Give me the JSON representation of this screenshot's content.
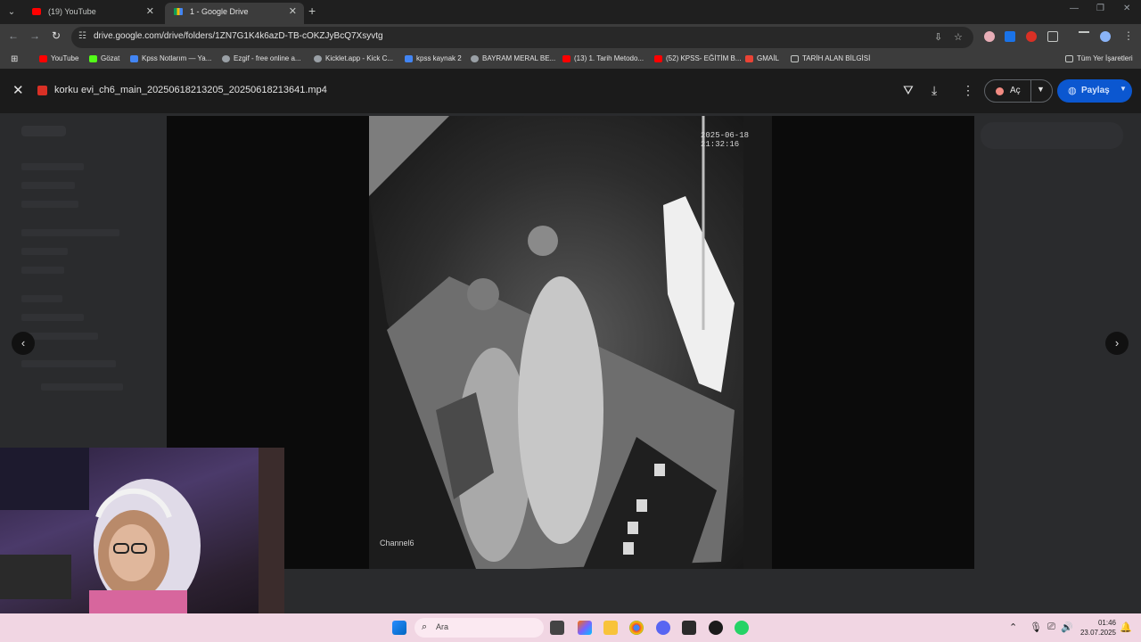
{
  "tabs": [
    {
      "title": "(19) YouTube",
      "favicon": "youtube-icon",
      "active": false
    },
    {
      "title": "1 - Google Drive",
      "favicon": "google-drive-icon",
      "active": true
    }
  ],
  "address_bar": {
    "url": "drive.google.com/drive/folders/1ZN7G1K4k6azD-TB-cOKZJyBcQ7Xsyvtg"
  },
  "bookmarks": [
    {
      "label": "YouTube",
      "color": "#ff0000"
    },
    {
      "label": "Gözat",
      "color": "#53fc18"
    },
    {
      "label": "Kpss Notlarım — Ya...",
      "color": "#4285f4"
    },
    {
      "label": "Ezgif - free online a...",
      "color": "#9aa0a6"
    },
    {
      "label": "Kicklet.app - Kick C...",
      "color": "#9aa0a6"
    },
    {
      "label": "kpss kaynak 2",
      "color": "#4285f4"
    },
    {
      "label": "BAYRAM MERAL BE...",
      "color": "#9aa0a6"
    },
    {
      "label": "(13) 1. Tarih Metodo...",
      "color": "#ff0000"
    },
    {
      "label": "(52) KPSS- EĞİTİM B...",
      "color": "#ff0000"
    },
    {
      "label": "GMAİL",
      "color": "#ea4335"
    },
    {
      "label": "TARİH ALAN BİLGİSİ",
      "color": "#9aa0a6"
    }
  ],
  "all_bookmarks": "Tüm Yer İşaretleri",
  "viewer": {
    "file_name": "korku evi_ch6_main_20250618213205_20250618213641.mp4",
    "open_with_label": "Aç",
    "share_label": "Paylaş"
  },
  "video": {
    "timestamp": "2025-06-18 21:32:16",
    "channel_label": "Channel6"
  },
  "taskbar": {
    "search_label": "Ara",
    "time": "01:46",
    "date": "23.07.2025"
  }
}
